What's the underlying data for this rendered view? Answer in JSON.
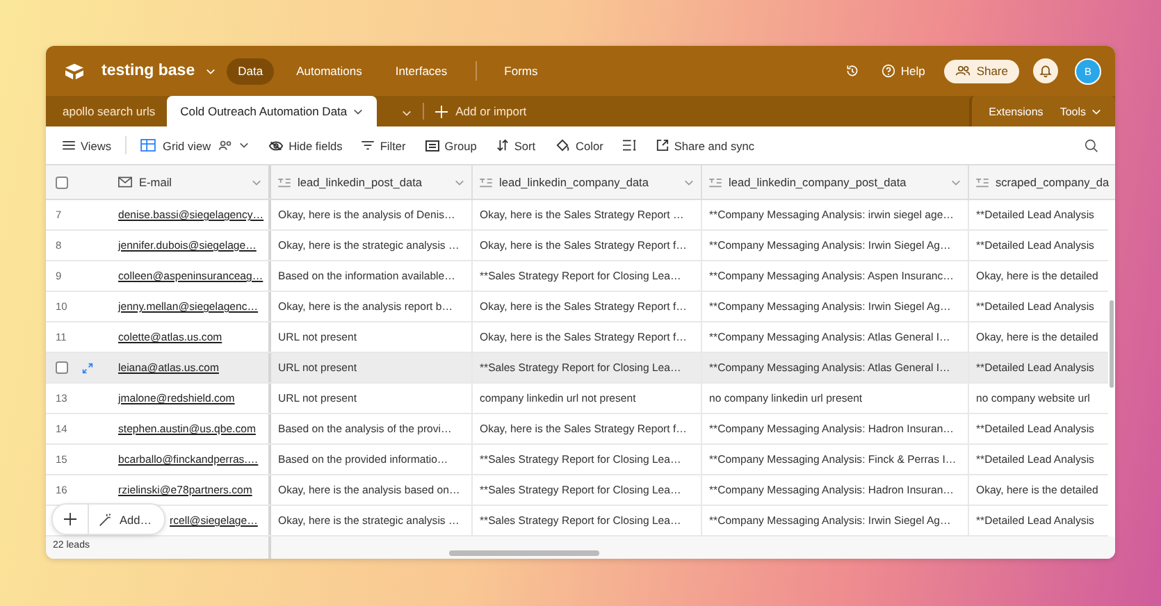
{
  "app": {
    "base_name": "testing base",
    "nav": [
      {
        "label": "Data",
        "selected": true
      },
      {
        "label": "Automations",
        "selected": false
      },
      {
        "label": "Interfaces",
        "selected": false
      },
      {
        "label": "Forms",
        "selected": false
      }
    ],
    "help": "Help",
    "share": "Share",
    "avatar": "B"
  },
  "table_tabs": {
    "items": [
      {
        "label": "apollo search urls",
        "selected": false
      },
      {
        "label": "Cold Outreach Automation Data",
        "selected": true
      }
    ],
    "add": "Add or import",
    "extensions": "Extensions",
    "tools": "Tools"
  },
  "toolbar": {
    "views": "Views",
    "view_name": "Grid view",
    "actions": [
      {
        "kind": "hide",
        "label": "Hide fields"
      },
      {
        "kind": "filter",
        "label": "Filter"
      },
      {
        "kind": "group",
        "label": "Group"
      },
      {
        "kind": "sort",
        "label": "Sort"
      },
      {
        "kind": "color",
        "label": "Color"
      },
      {
        "kind": "height"
      },
      {
        "kind": "share",
        "label": "Share and sync"
      }
    ]
  },
  "table": {
    "select_all_checked": false,
    "columns": [
      {
        "kind": "email",
        "label": "E-mail"
      },
      {
        "kind": "text",
        "label": "lead_linkedin_post_data"
      },
      {
        "kind": "text",
        "label": "lead_linkedin_company_data"
      },
      {
        "kind": "text",
        "label": "lead_linkedin_company_post_data"
      },
      {
        "kind": "text",
        "label": "scraped_company_da"
      }
    ],
    "rows": [
      {
        "number": "7",
        "hovered": false,
        "cells": [
          "denise.bassi@siegelagency…",
          "Okay, here is the analysis of Denis…",
          "Okay, here is the Sales Strategy Report …",
          "**Company Messaging Analysis: irwin siegel age…",
          "**Detailed Lead Analysis"
        ]
      },
      {
        "number": "8",
        "hovered": false,
        "cells": [
          "jennifer.dubois@siegelage…",
          "Okay, here is the strategic analysis …",
          "Okay, here is the Sales Strategy Report f…",
          "**Company Messaging Analysis: Irwin Siegel Ag…",
          "**Detailed Lead Analysis"
        ]
      },
      {
        "number": "9",
        "hovered": false,
        "cells": [
          "colleen@aspeninsuranceag…",
          "Based on the information available…",
          "**Sales Strategy Report for Closing Lea…",
          "**Company Messaging Analysis: Aspen Insuranc…",
          "Okay, here is the detailed"
        ]
      },
      {
        "number": "10",
        "hovered": false,
        "cells": [
          "jenny.mellan@siegelagenc…",
          "Okay, here is the analysis report b…",
          "Okay, here is the Sales Strategy Report f…",
          "**Company Messaging Analysis: Irwin Siegel Ag…",
          "**Detailed Lead Analysis"
        ]
      },
      {
        "number": "11",
        "hovered": false,
        "cells": [
          "colette@atlas.us.com",
          "URL not present",
          "Okay, here is the Sales Strategy Report f…",
          "**Company Messaging Analysis: Atlas General I…",
          "Okay, here is the detailed"
        ]
      },
      {
        "hovered": true,
        "checked": false,
        "cells": [
          "leiana@atlas.us.com",
          "URL not present",
          "**Sales Strategy Report for Closing Lea…",
          "**Company Messaging Analysis: Atlas General I…",
          "**Detailed Lead Analysis"
        ]
      },
      {
        "number": "13",
        "hovered": false,
        "cells": [
          "jmalone@redshield.com",
          "URL not present",
          "company linkedin url not present",
          "no company linkedin url present",
          "no company website url"
        ]
      },
      {
        "number": "14",
        "hovered": false,
        "cells": [
          "stephen.austin@us.qbe.com",
          "Based on the analysis of the provi…",
          "Okay, here is the Sales Strategy Report f…",
          "**Company Messaging Analysis: Hadron Insuran…",
          "**Detailed Lead Analysis"
        ]
      },
      {
        "number": "15",
        "hovered": false,
        "cells": [
          "bcarballo@finckandperras.…",
          "Based on the provided informatio…",
          "**Sales Strategy Report for Closing Lea…",
          "**Company Messaging Analysis: Finck & Perras I…",
          "**Detailed Lead Analysis"
        ]
      },
      {
        "number": "16",
        "hovered": false,
        "cells": [
          "rzielinski@e78partners.com",
          "Okay, here is the analysis based on…",
          "**Sales Strategy Report for Closing Lea…",
          "**Company Messaging Analysis: Hadron Insuran…",
          "Okay, here is the detailed"
        ]
      },
      {
        "hovered": false,
        "cells": [
          "rcell@siegelage…",
          "Okay, here is the strategic analysis …",
          "**Sales Strategy Report for Closing Lea…",
          "**Company Messaging Analysis: Irwin Siegel Ag…",
          "**Detailed Lead Analysis"
        ]
      }
    ],
    "add": "Add…",
    "footer": "22 leads"
  }
}
